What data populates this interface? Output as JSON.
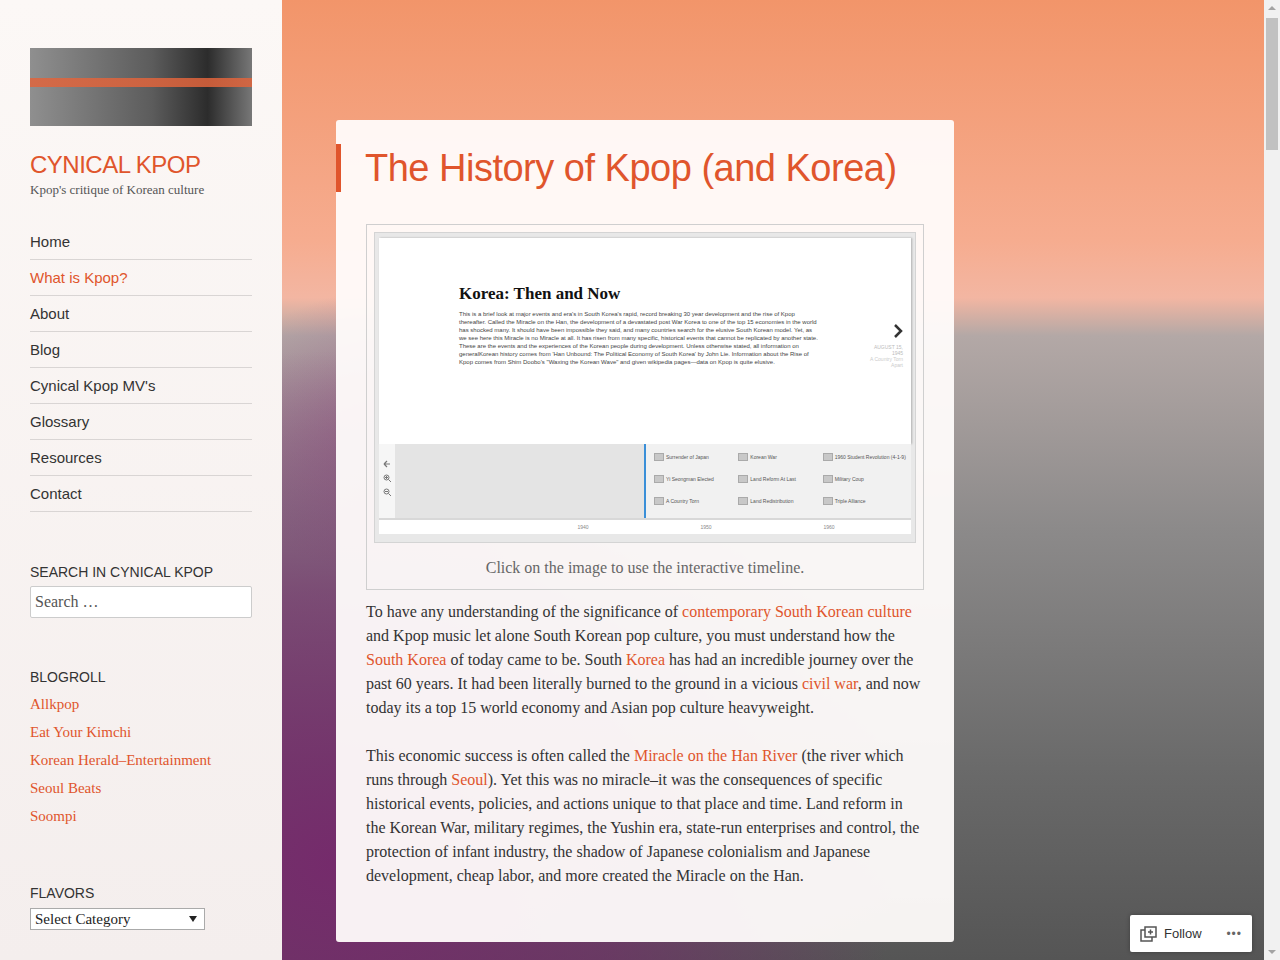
{
  "sidebar": {
    "site_title": "CYNICAL KPOP",
    "tagline": "Kpop's critique of Korean culture",
    "nav": [
      {
        "label": "Home",
        "selected": false
      },
      {
        "label": "What is Kpop?",
        "selected": true
      },
      {
        "label": "About",
        "selected": false
      },
      {
        "label": "Blog",
        "selected": false
      },
      {
        "label": "Cynical Kpop MV's",
        "selected": false
      },
      {
        "label": "Glossary",
        "selected": false
      },
      {
        "label": "Resources",
        "selected": false
      },
      {
        "label": "Contact",
        "selected": false
      }
    ],
    "search": {
      "heading": "SEARCH IN CYNICAL KPOP",
      "placeholder": "Search …"
    },
    "blogroll": {
      "heading": "BLOGROLL",
      "links": [
        "Allkpop",
        "Eat Your Kimchi",
        "Korean Herald–Entertainment",
        "Seoul Beats",
        "Soompi"
      ]
    },
    "flavors": {
      "heading": "FLAVORS",
      "select": "Select Category"
    }
  },
  "post": {
    "title": "The History of Kpop (and Korea)",
    "timeline": {
      "title": "Korea: Then and Now",
      "intro": "This is a brief look at major events and era's in South Korea's rapid, record breaking 30 year development and the rise of Kpop thereafter. Called the Miracle on the Han, the development of a devastated post War Korea to one of the top 15 economies in the world has shocked many. It should have been impossible they said, and many countries search for the elusive South Korean model. Yet, as we see here this Miracle is no Miracle at all. It has risen from many specific, historical events that cannot be replicated by another state. These are the events and the experiences of the Korean people during development. Unless otherwise stated, all information on generalKorean history comes from 'Han Unbound: The Political Economy of South Korea' by John Lie. Information about the Rise of Kpop comes from Shim Doobo's \"Waxing the Korean Wave\" and given wikipedia pages—data on Kpop is quite elusive.",
      "side_date": "AUGUST 15, 1945",
      "side_note": "A Country Torn Apart",
      "events": [
        "Surrender of Japan",
        "Korean War",
        "1960 Student Revolution (4-1-9)",
        "Yi Seongman Elected",
        "Land Reform At Last",
        "Military Coup",
        "A Country Torn",
        "Land Redistribution",
        "Triple Alliance"
      ],
      "axis": [
        "1940",
        "1950",
        "1960"
      ]
    },
    "caption": "Click on the image to use the interactive timeline.",
    "paragraphs": [
      [
        {
          "text": "To have any understanding of the significance of ",
          "link": false
        },
        {
          "text": "contemporary South Korean culture",
          "link": true
        },
        {
          "text": " and Kpop music let alone South Korean pop culture, you must understand how the ",
          "link": false
        },
        {
          "text": "South Korea",
          "link": true
        },
        {
          "text": " of today came to be. South ",
          "link": false
        },
        {
          "text": "Korea",
          "link": true
        },
        {
          "text": " has had an incredible journey over the past 60 years. It had been literally burned to the ground in a vicious ",
          "link": false
        },
        {
          "text": "civil war",
          "link": true
        },
        {
          "text": ", and now today its a top 15 world economy and Asian pop culture heavyweight.",
          "link": false
        }
      ],
      [
        {
          "text": "This economic success is often called the ",
          "link": false
        },
        {
          "text": "Miracle on the Han River",
          "link": true
        },
        {
          "text": " (the river which runs through ",
          "link": false
        },
        {
          "text": "Seoul",
          "link": true
        },
        {
          "text": "). Yet this was no miracle–it was the consequences of specific historical events, policies, and actions unique to that place and time. Land reform in the Korean War, military regimes, the Yushin era, state-run enterprises and control, the protection of infant industry, the shadow of Japanese colonialism and Japanese development,  cheap labor, and more created the Miracle on the Han.",
          "link": false
        }
      ]
    ]
  },
  "follow": {
    "label": "Follow",
    "more": "•••"
  }
}
